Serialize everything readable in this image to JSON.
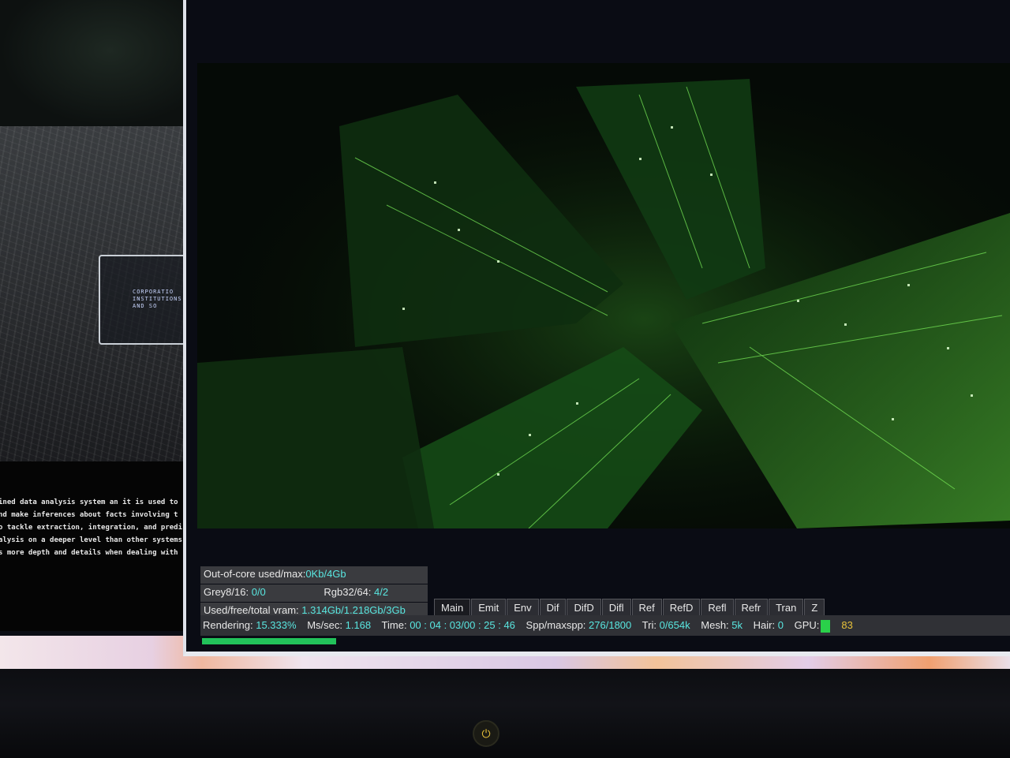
{
  "document": {
    "badge_text": "CORPORATIO\nINSTITUTIONS\nAND SO",
    "lines": [
      "ined data analysis system an it is used to",
      "nd make inferences about facts involving  t",
      "o tackle extraction, integration, and predi",
      "alysis on a deeper level than other systems",
      "s more depth and details when dealing  with"
    ]
  },
  "renderer": {
    "outofcore_label": "Out-of-core used/max:",
    "outofcore_value": "0Kb/4Gb",
    "grey_label": "Grey8/16:",
    "grey_value": "0/0",
    "rgb_label": "Rgb32/64:",
    "rgb_value": "4/2",
    "vram_label": "Used/free/total vram:",
    "vram_value": "1.314Gb/1.218Gb/3Gb",
    "tabs": [
      "Main",
      "Emit",
      "Env",
      "Dif",
      "DifD",
      "Difl",
      "Ref",
      "RefD",
      "Refl",
      "Refr",
      "Tran",
      "Z"
    ],
    "status": {
      "rendering_label": "Rendering:",
      "rendering_value": "15.333%",
      "mssec_label": "Ms/sec:",
      "mssec_value": "1.168",
      "time_label": "Time:",
      "time_value": "00 : 04 : 03/00 : 25 : 46",
      "spp_label": "Spp/maxspp:",
      "spp_value": "276/1800",
      "tri_label": "Tri:",
      "tri_value": "0/654k",
      "mesh_label": "Mesh:",
      "mesh_value": "5k",
      "hair_label": "Hair:",
      "hair_value": "0",
      "gpu_label": "GPU:",
      "gpu_temp": "83"
    },
    "progress_percent": 15.333
  },
  "colors": {
    "value_cyan": "#59e6e0",
    "gpu_green": "#2ad14a",
    "temp_yellow": "#e8c23a",
    "progress_green": "#22c25a"
  },
  "icons": {
    "power": "power-icon"
  }
}
